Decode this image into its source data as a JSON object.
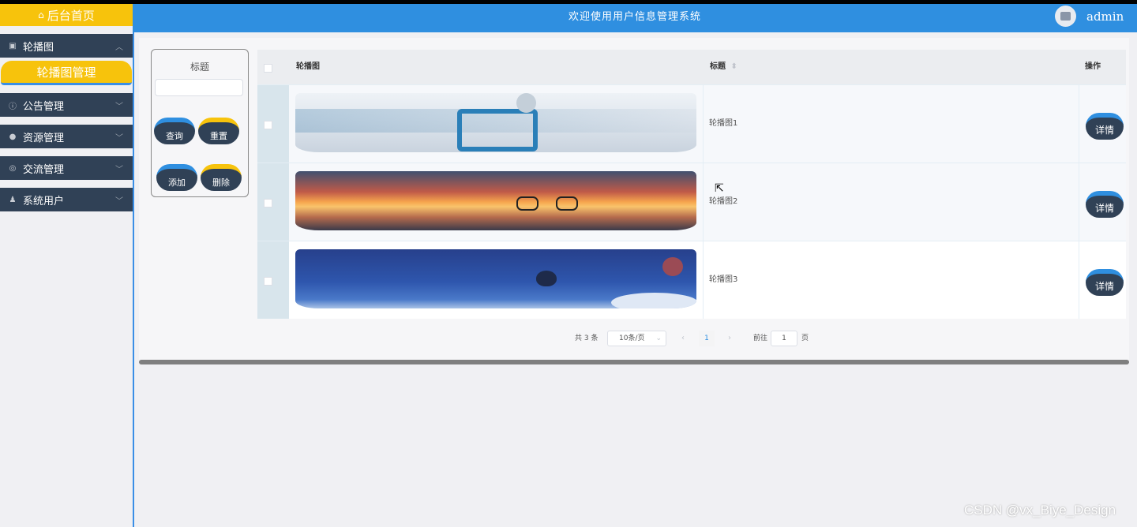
{
  "sidebar": {
    "home_label": "后台首页",
    "menus": [
      {
        "label": "轮播图",
        "icon": "image-icon",
        "sub": [
          "轮播图管理"
        ]
      },
      {
        "label": "公告管理",
        "icon": "info-icon"
      },
      {
        "label": "资源管理",
        "icon": "location-icon"
      },
      {
        "label": "交流管理",
        "icon": "chat-icon"
      },
      {
        "label": "系统用户",
        "icon": "user-icon"
      }
    ]
  },
  "header": {
    "title": "欢迎使用用户信息管理系统",
    "username": "admin"
  },
  "search": {
    "label": "标题",
    "value": "",
    "buttons": [
      "查询",
      "重置",
      "添加",
      "删除"
    ]
  },
  "table": {
    "columns": [
      "轮播图",
      "标题",
      "操作"
    ],
    "rows": [
      {
        "title": "轮播图1",
        "action": "详情"
      },
      {
        "title": "轮播图2",
        "action": "详情"
      },
      {
        "title": "轮播图3",
        "action": "详情"
      }
    ]
  },
  "pagination": {
    "total": "共 3 条",
    "page_size": "10条/页",
    "current": "1",
    "goto_label": "前往",
    "goto_value": "1",
    "page_suffix": "页"
  },
  "watermark": "CSDN @vx_Biye_Design",
  "colors": {
    "accent": "#2f8fe0",
    "gold": "#f7c30c",
    "dark": "#304156"
  }
}
